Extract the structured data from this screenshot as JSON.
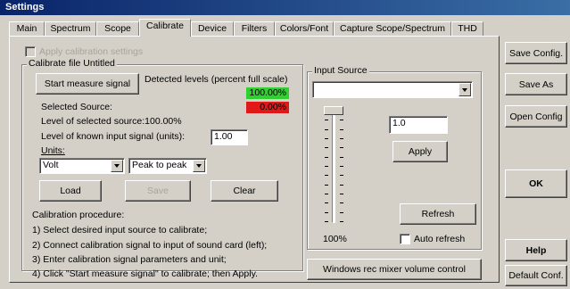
{
  "window": {
    "title": "Settings"
  },
  "tabs": [
    {
      "label": "Main",
      "active": false
    },
    {
      "label": "Spectrum",
      "active": false
    },
    {
      "label": "Scope",
      "active": false
    },
    {
      "label": "Calibrate",
      "active": true
    },
    {
      "label": "Device",
      "active": false
    },
    {
      "label": "Filters",
      "active": false
    },
    {
      "label": "Colors/Font",
      "active": false
    },
    {
      "label": "Capture Scope/Spectrum",
      "active": false
    },
    {
      "label": "THD",
      "active": false
    }
  ],
  "calibrate": {
    "apply_calibration_label": "Apply calibration settings",
    "apply_calibration_checked": false,
    "group_title": "Calibrate file Untitled",
    "start_measure_label": "Start measure signal",
    "detected_levels_label": "Detected levels (percent full scale)",
    "level_green": "100.00%",
    "level_red": "0.00%",
    "selected_source_label": "Selected Source:",
    "level_selected_label": "Level of selected source:100.00%",
    "known_level_label": "Level of known input signal (units):",
    "known_level_value": "1.00",
    "units_label": "Units:",
    "units_value": "Volt",
    "mode_value": "Peak to peak",
    "load_label": "Load",
    "save_label": "Save",
    "clear_label": "Clear",
    "procedure_title": "Calibration procedure:",
    "steps": [
      "1) Select desired input source to calibrate;",
      "2) Connect calibration signal to input of sound card (left);",
      "3) Enter calibration signal parameters and unit;",
      "4) Click \"Start measure signal\" to calibrate; then Apply."
    ]
  },
  "input_source": {
    "title": "Input Source",
    "selected": "",
    "gain_value": "1.0",
    "apply_label": "Apply",
    "slider_percent": "100%",
    "slider_level": 1.0,
    "refresh_label": "Refresh",
    "auto_refresh_label": "Auto refresh",
    "auto_refresh_checked": false,
    "mixer_label": "Windows rec mixer volume control"
  },
  "sidebar": {
    "save_config": "Save Config.",
    "save_as": "Save As",
    "open_config": "Open Config",
    "ok": "OK",
    "help": "Help",
    "default_conf": "Default Conf."
  },
  "colors": {
    "level_green": "#2fd02f",
    "level_red": "#e01818",
    "title_bar": "#0a246a"
  }
}
